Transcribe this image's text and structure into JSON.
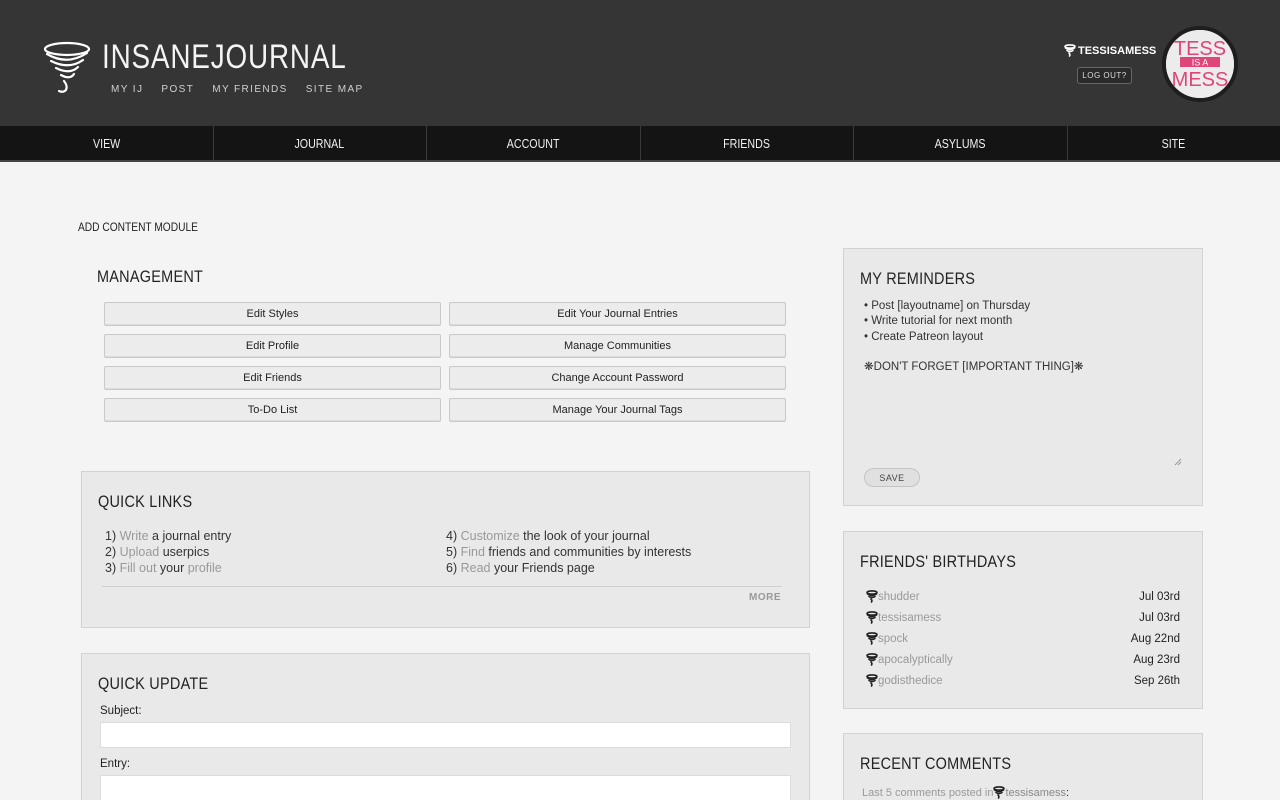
{
  "header": {
    "site_name": "INSANEJOURNAL",
    "sub_links": [
      "MY IJ",
      "POST",
      "MY FRIENDS",
      "SITE MAP"
    ],
    "username": "TESSISAMESS",
    "logout_label": "LOG OUT?",
    "avatar_text": {
      "line1": "TESS",
      "line2": "IS A",
      "line3": "MESS"
    }
  },
  "nav": [
    "VIEW",
    "JOURNAL",
    "ACCOUNT",
    "FRIENDS",
    "ASYLUMS",
    "SITE"
  ],
  "add_content_label": "ADD CONTENT MODULE",
  "management": {
    "title": "MANAGEMENT",
    "buttons": [
      "Edit Styles",
      "Edit Your Journal Entries",
      "Edit Profile",
      "Manage Communities",
      "Edit Friends",
      "Change Account Password",
      "To-Do List",
      "Manage Your Journal Tags"
    ]
  },
  "quick_links": {
    "title": "QUICK LINKS",
    "items": [
      {
        "num": "1)",
        "link": "Write",
        "rest": " a journal entry"
      },
      {
        "num": "2)",
        "link": "Upload",
        "rest": " userpics"
      },
      {
        "num": "3)",
        "link": "Fill out",
        "rest": " your ",
        "link2": "profile"
      },
      {
        "num": "4)",
        "link": "Customize",
        "rest": " the look of your journal"
      },
      {
        "num": "5)",
        "link": "Find",
        "rest": " friends and communities by interests"
      },
      {
        "num": "6)",
        "link": "Read",
        "rest": " your Friends page"
      }
    ],
    "more_label": "MORE"
  },
  "quick_update": {
    "title": "QUICK UPDATE",
    "subject_label": "Subject:",
    "entry_label": "Entry:"
  },
  "reminders": {
    "title": "MY REMINDERS",
    "text": "• Post [layoutname] on Thursday\n• Write tutorial for next month\n• Create Patreon layout\n\n❋DON'T FORGET [IMPORTANT THING]❋",
    "save_label": "SAVE"
  },
  "birthdays": {
    "title": "FRIENDS' BIRTHDAYS",
    "rows": [
      {
        "user": "shudder",
        "date": "Jul 03rd"
      },
      {
        "user": "tessisamess",
        "date": "Jul 03rd"
      },
      {
        "user": "spock",
        "date": "Aug 22nd"
      },
      {
        "user": "apocalyptically",
        "date": "Aug 23rd"
      },
      {
        "user": "godisthedice",
        "date": "Sep 26th"
      }
    ]
  },
  "recent_comments": {
    "title": "RECENT COMMENTS",
    "prefix": "Last 5 comments posted in ",
    "user": "tessisamess",
    "suffix": ":"
  },
  "colors": {
    "header_bg": "#353535",
    "nav_bg": "#141414",
    "page_bg": "#f4f4f4",
    "panel_bg": "#e9e9e9",
    "link_gray": "#999999",
    "avatar_pink": "#e0457a"
  }
}
